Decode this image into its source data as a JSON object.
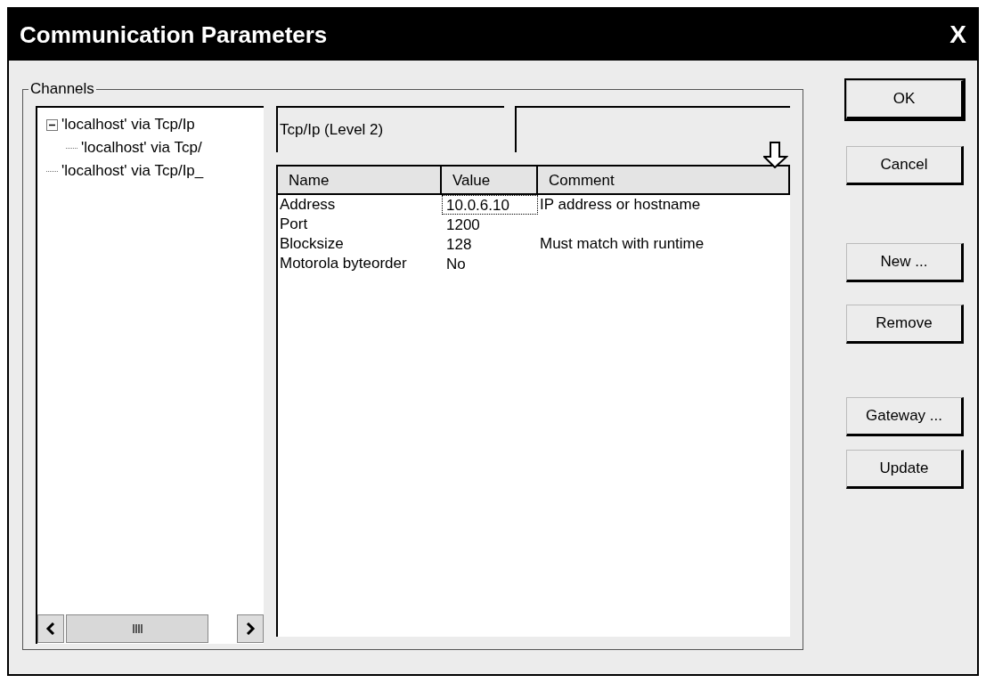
{
  "window": {
    "title": "Communication Parameters",
    "close": "X"
  },
  "channels": {
    "label": "Channels",
    "tree": [
      {
        "label": "'localhost' via Tcp/Ip",
        "expanded": true,
        "children": [
          {
            "label": "'localhost' via Tcp/"
          }
        ]
      },
      {
        "label": "'localhost' via Tcp/Ip_"
      }
    ]
  },
  "driver": {
    "name": "Tcp/Ip (Level 2)"
  },
  "table": {
    "columns": [
      "Name",
      "Value",
      "Comment"
    ],
    "rows": [
      {
        "name": "Address",
        "value": "10.0.6.10",
        "comment": "IP address or hostname",
        "focused": true
      },
      {
        "name": "Port",
        "value": "1200",
        "focused": false
      },
      {
        "name": "Blocksize",
        "value": "128",
        "comment": "Must match with runtime",
        "focused": false
      },
      {
        "name": "Motorola byteorder",
        "value": "No",
        "focused": false
      }
    ]
  },
  "buttons": [
    {
      "label": "OK",
      "default": true
    },
    {
      "label": "Cancel",
      "default": false
    },
    {
      "label": "New ...",
      "default": false
    },
    {
      "label": "Remove",
      "default": false
    },
    {
      "label": "Gateway ...",
      "default": false
    },
    {
      "label": "Update",
      "default": false
    }
  ]
}
